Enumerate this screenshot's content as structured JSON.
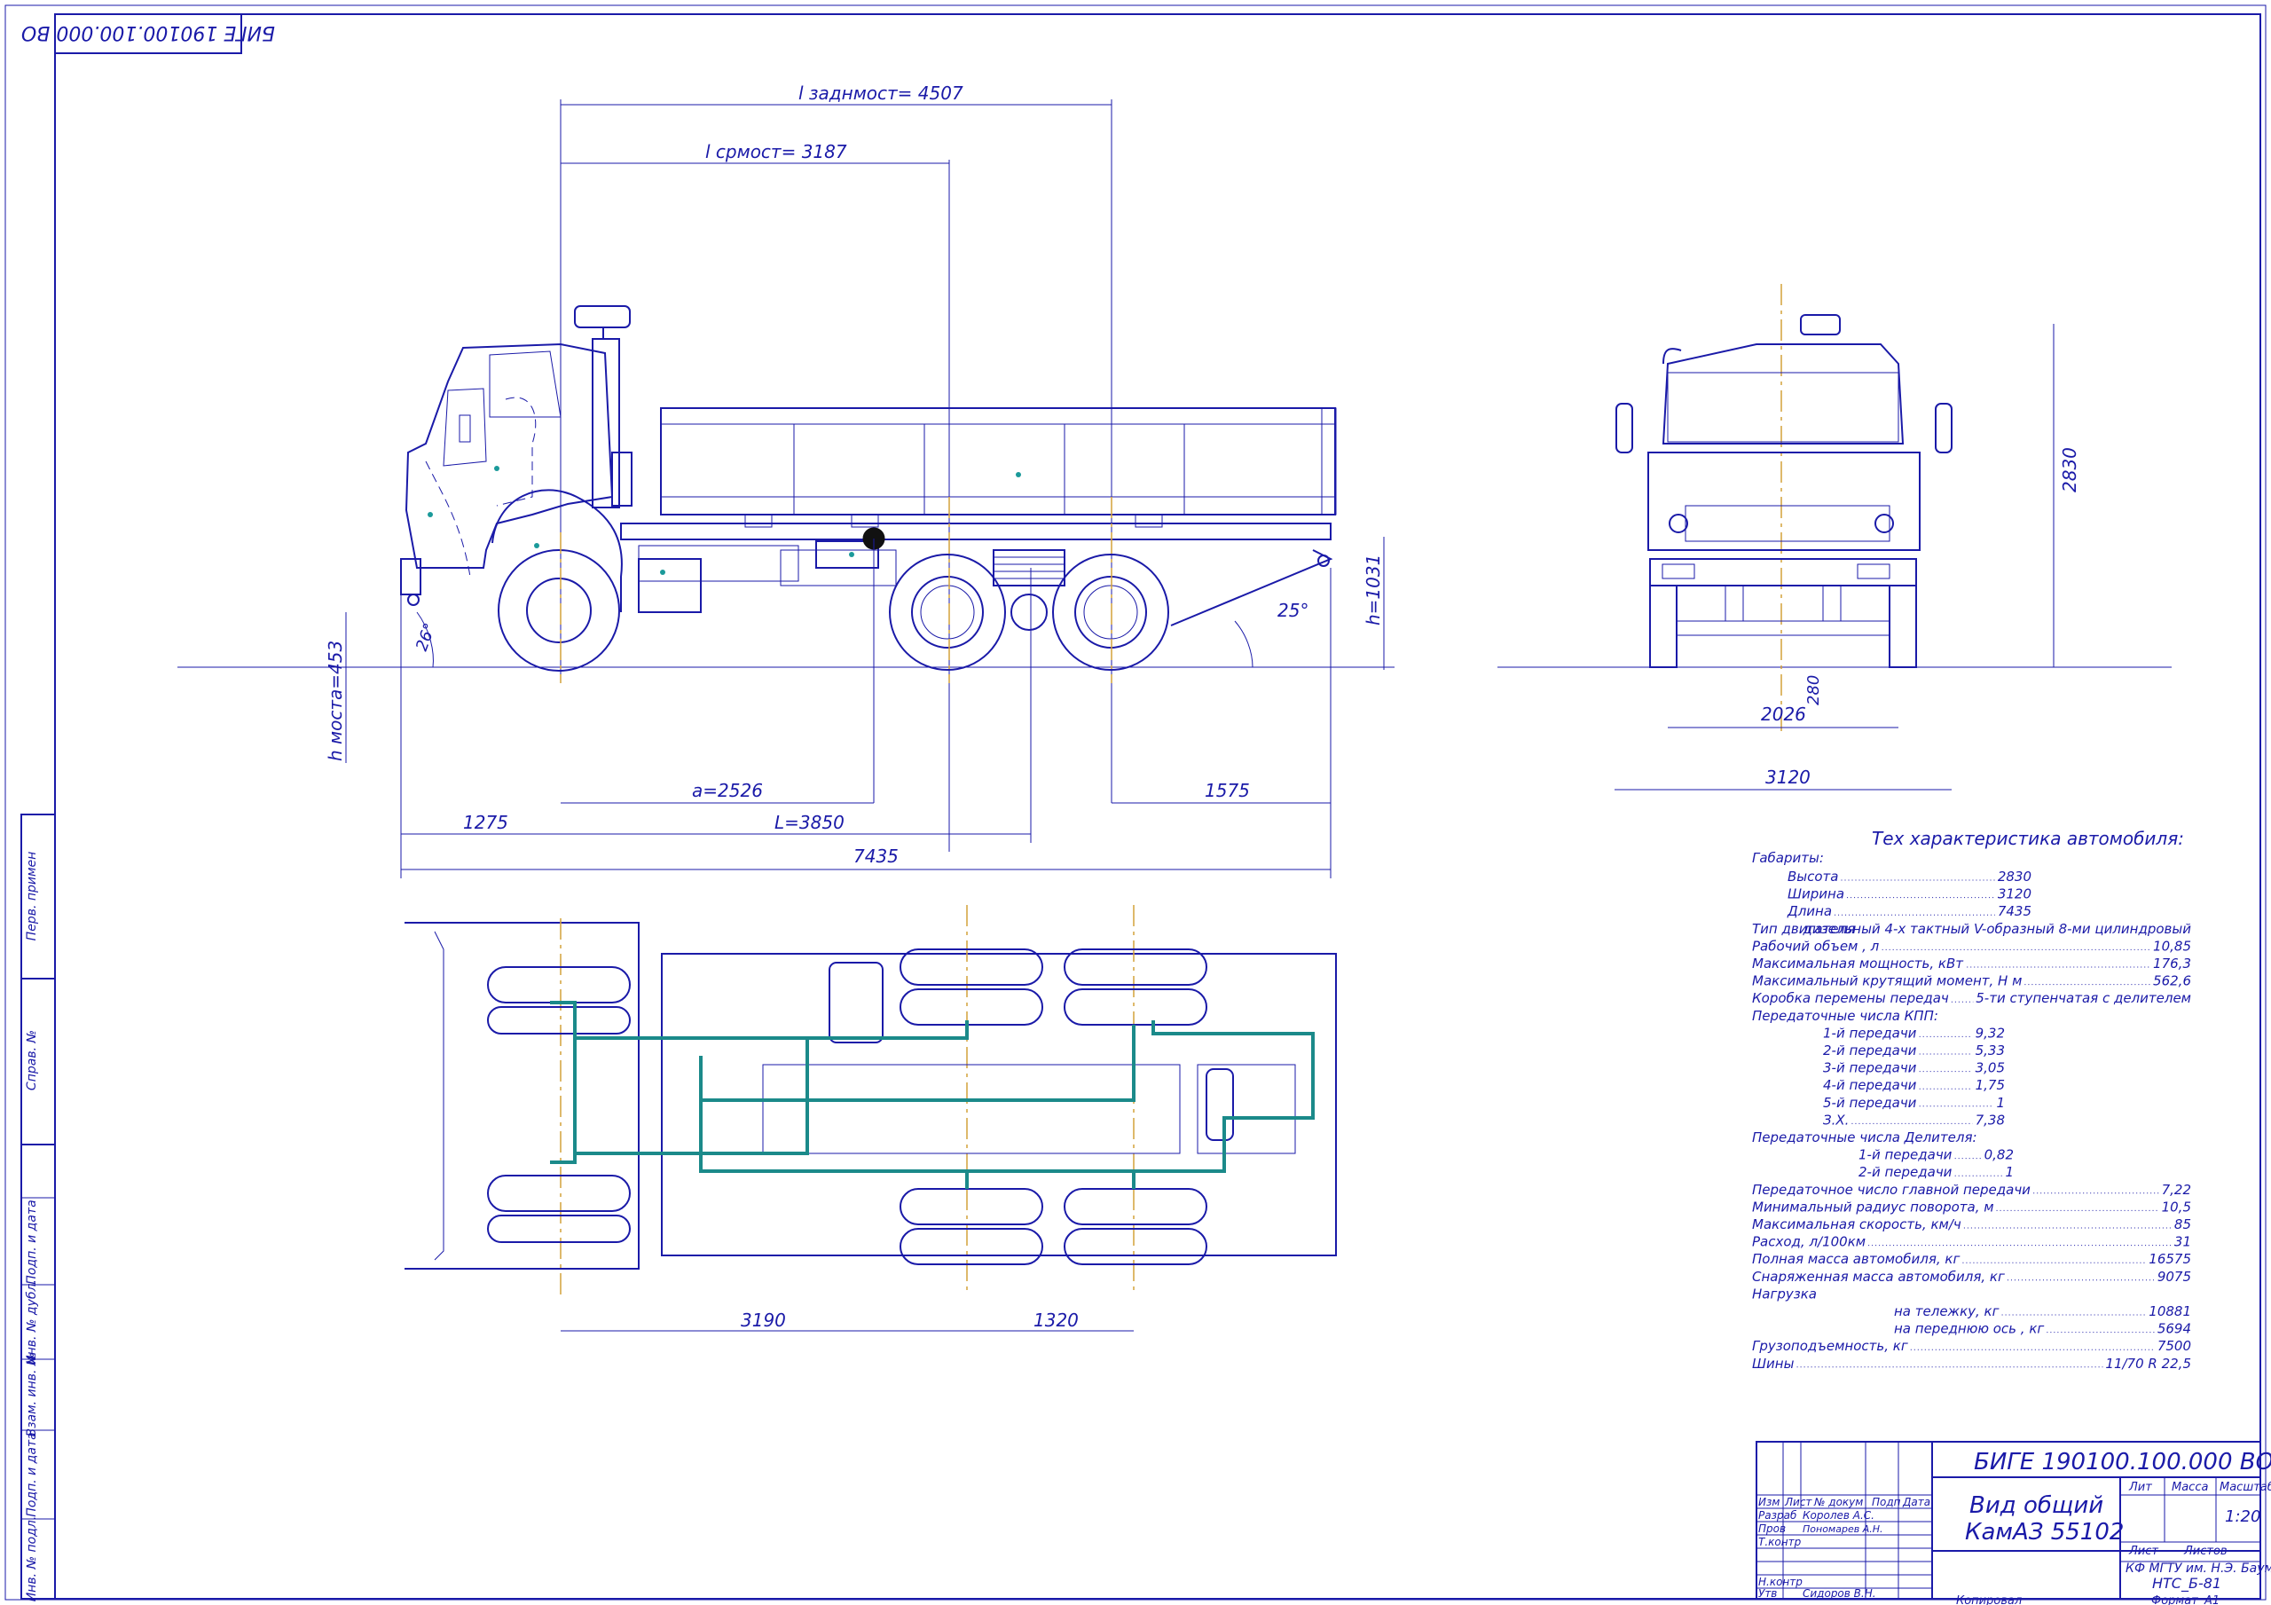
{
  "stamp_code_mirrored": "БИГЕ 190100.100.000 ВО",
  "side_dims": {
    "l_zadn_most": "l заднмост= 4507",
    "l_sr_most": "l срмост= 3187",
    "angle_front": "26°",
    "angle_rear": "25°",
    "h_frame": "h=1031",
    "h_most": "h мостa=453",
    "a": "a=2526",
    "L": "L=3850",
    "rear_overhang": "1575",
    "front_overhang": "1275",
    "overall_length": "7435"
  },
  "front_dims": {
    "height": "2830",
    "track": "2026",
    "clearance": "280",
    "width": "3120"
  },
  "top_dims": {
    "base1": "3190",
    "base2": "1320"
  },
  "specs": {
    "title": "Тех характеристика автомобиля:",
    "gabarity": "Габариты:",
    "lines": [
      {
        "label": "Высота",
        "value": "2830"
      },
      {
        "label": "Ширина",
        "value": "3120"
      },
      {
        "label": "Длина",
        "value": "7435"
      },
      {
        "label": "Тип двигателя",
        "value": "дизельный 4-х тактный V-образный 8-ми цилиндровый"
      },
      {
        "label": "Рабочий объем , л",
        "value": "10,85"
      },
      {
        "label": "Максимальная мощность, кВт",
        "value": "176,3"
      },
      {
        "label": "Максимальный крутящий момент, Н м",
        "value": "562,6"
      },
      {
        "label": "Коробка перемены передач",
        "value": "5-ти ступенчатая с делителем"
      },
      {
        "label": "Передаточные числа КПП:",
        "value": ""
      },
      {
        "label": "1-й передачи",
        "value": "9,32"
      },
      {
        "label": "2-й передачи",
        "value": "5,33"
      },
      {
        "label": "3-й передачи",
        "value": "3,05"
      },
      {
        "label": "4-й передачи",
        "value": "1,75"
      },
      {
        "label": "5-й передачи",
        "value": "1"
      },
      {
        "label": "З.Х.",
        "value": "7,38"
      },
      {
        "label": "Передаточные числа Делителя:",
        "value": ""
      },
      {
        "label": "1-й передачи",
        "value": "0,82"
      },
      {
        "label": "2-й передачи",
        "value": "1"
      },
      {
        "label": "Передаточное число главной передачи",
        "value": "7,22"
      },
      {
        "label": "Минимальный радиус поворота, м",
        "value": "10,5"
      },
      {
        "label": "Максимальная скорость, км/ч",
        "value": "85"
      },
      {
        "label": "Расход, л/100км",
        "value": "31"
      },
      {
        "label": "Полная масса автомобиля, кг",
        "value": "16575"
      },
      {
        "label": "Снаряженная масса автомобиля, кг",
        "value": "9075"
      },
      {
        "label": "Нагрузка",
        "value": ""
      },
      {
        "label": "на тележку, кг",
        "value": "10881"
      },
      {
        "label": "на переднюю ось , кг",
        "value": "5694"
      },
      {
        "label": "Грузоподъемность, кг",
        "value": "7500"
      },
      {
        "label": "Шины",
        "value": "11/70 R 22,5"
      }
    ]
  },
  "title_block": {
    "code": "БИГЕ 190100.100.000 ВО",
    "name_line1": "Вид общий",
    "name_line2": "КамАЗ 55102",
    "col_izm": "Изм",
    "col_list": "Лист",
    "col_doc": "№ докум",
    "col_podp": "Подп",
    "col_data": "Дата",
    "razrab": "Разраб",
    "razrab_name": "Королев А.С.",
    "prov": "Пров",
    "prov_name": "Пономарев А.Н.",
    "tkontr": "Т.контр",
    "nkontr": "Н.контр",
    "utv": "Утв",
    "utv_name": "Сидоров В.Н.",
    "lit": "Лит",
    "massa": "Масса",
    "masshtab": "Масштаб",
    "scale": "1:20",
    "list": "Лист",
    "listov": "Листов",
    "org1": "КФ МГТУ им. Н.Э. Баумана",
    "org2": "НТС_Б-81",
    "kopiroval": "Копировал",
    "format": "Формат",
    "format_val": "А1"
  },
  "side_stamp": {
    "perv_primen": "Перв. примен",
    "sprav": "Справ. №",
    "podp_data": "Подп. и дата",
    "inv_dubl": "Инв. № дубл.",
    "vzam_inv": "Взам. инв. №",
    "podp_data2": "Подп. и дата",
    "inv_podl": "Инв. № подл."
  }
}
